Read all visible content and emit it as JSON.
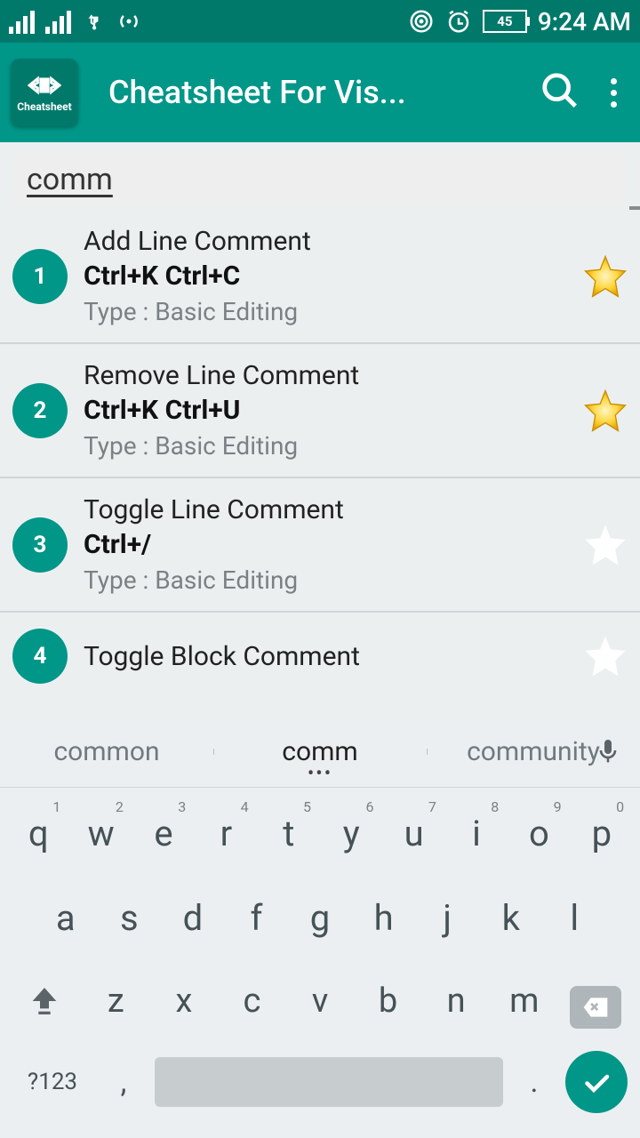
{
  "status": {
    "battery": "45",
    "time": "9:24 AM"
  },
  "app": {
    "icon_label": "Cheatsheet",
    "title": "Cheatsheet For Vis..."
  },
  "search": {
    "value": "comm"
  },
  "rows": [
    {
      "num": "1",
      "title": "Add Line Comment",
      "shortcut": "Ctrl+K Ctrl+C",
      "type": "Type : Basic Editing",
      "starred": true
    },
    {
      "num": "2",
      "title": "Remove Line Comment",
      "shortcut": "Ctrl+K Ctrl+U",
      "type": "Type : Basic Editing",
      "starred": true
    },
    {
      "num": "3",
      "title": "Toggle Line Comment",
      "shortcut": "Ctrl+/",
      "type": "Type : Basic Editing",
      "starred": false
    },
    {
      "num": "4",
      "title": "Toggle Block Comment",
      "shortcut": "",
      "type": "",
      "starred": false
    }
  ],
  "suggestions": {
    "left": "common",
    "center": "comm",
    "right": "community"
  },
  "keys": {
    "row1": [
      "q",
      "w",
      "e",
      "r",
      "t",
      "y",
      "u",
      "i",
      "o",
      "p"
    ],
    "nums": [
      "1",
      "2",
      "3",
      "4",
      "5",
      "6",
      "7",
      "8",
      "9",
      "0"
    ],
    "row2": [
      "a",
      "s",
      "d",
      "f",
      "g",
      "h",
      "j",
      "k",
      "l"
    ],
    "row3": [
      "z",
      "x",
      "c",
      "v",
      "b",
      "n",
      "m"
    ],
    "sym": "?123",
    "comma": ",",
    "period": "."
  }
}
